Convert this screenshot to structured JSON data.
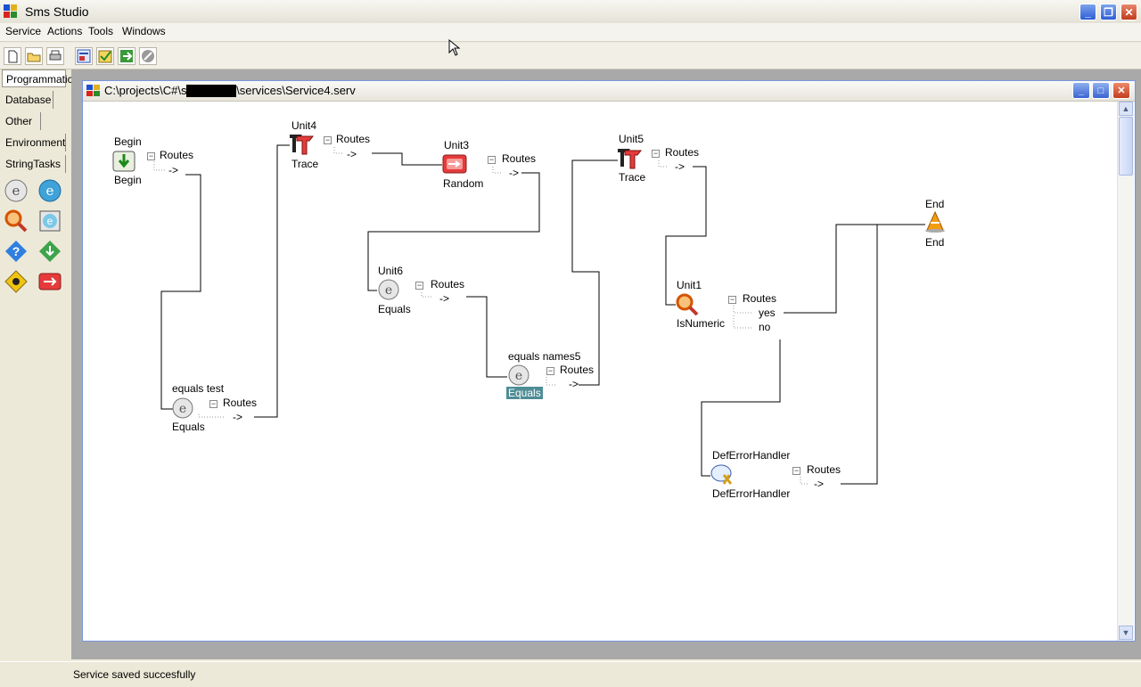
{
  "app": {
    "title": "Sms Studio",
    "status": "Service saved succesfully"
  },
  "menu": [
    "Service",
    "Actions",
    "Tools",
    "Windows"
  ],
  "toolbar": {
    "buttons": [
      "new-icon",
      "open-icon",
      "print-icon",
      "properties-icon",
      "validate-icon",
      "run-icon",
      "stop-icon"
    ]
  },
  "left_panel": {
    "categories": [
      "Programmatic",
      "Database",
      "Other",
      "Environment",
      "StringTasks"
    ],
    "active_category": "Programmatic",
    "tools": [
      "equals-icon",
      "equals-blue-icon",
      "isnumeric-icon",
      "equals-square-icon",
      "question-icon",
      "diamond-icon",
      "warning-icon",
      "random-icon"
    ]
  },
  "child_window": {
    "title": "C:\\projects\\C#\\sms studio\\services\\Service4.serv"
  },
  "diagram": {
    "routes_label": "Routes",
    "arrow": "->",
    "nodes": [
      {
        "id": "begin",
        "name": "Begin",
        "type": "Begin",
        "icon": "begin-icon"
      },
      {
        "id": "unit4",
        "name": "Unit4",
        "type": "Trace",
        "icon": "trace-icon"
      },
      {
        "id": "unit3",
        "name": "Unit3",
        "type": "Random",
        "icon": "random-icon"
      },
      {
        "id": "unit5",
        "name": "Unit5",
        "type": "Trace",
        "icon": "trace-icon"
      },
      {
        "id": "end",
        "name": "End",
        "type": "End",
        "icon": "end-icon"
      },
      {
        "id": "unit6",
        "name": "Unit6",
        "type": "Equals",
        "icon": "equals-icon"
      },
      {
        "id": "unit1",
        "name": "Unit1",
        "type": "IsNumeric",
        "icon": "isnumeric-icon",
        "routes": [
          "yes",
          "no"
        ]
      },
      {
        "id": "equals_names5",
        "name": "equals names5",
        "type": "Equals",
        "icon": "equals-icon",
        "selected": true
      },
      {
        "id": "equals_test",
        "name": "equals test",
        "type": "Equals",
        "icon": "equals-icon"
      },
      {
        "id": "def_error",
        "name": "DefErrorHandler",
        "type": "DefErrorHandler",
        "icon": "error-handler-icon"
      }
    ]
  }
}
